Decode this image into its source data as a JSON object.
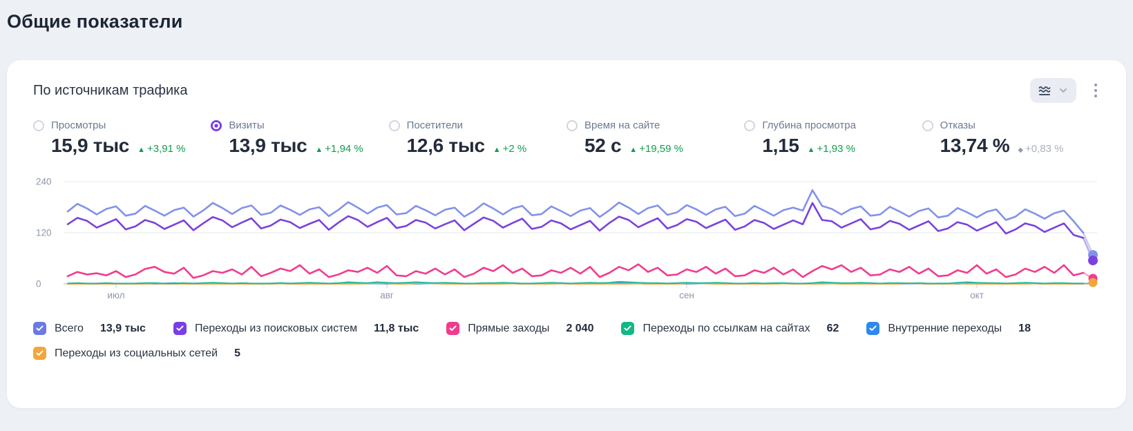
{
  "page": {
    "title": "Общие показатели"
  },
  "card": {
    "title": "По источникам трафика",
    "controls": {
      "chart_type_icon": "wave-lines-icon",
      "expand_icon": "chevron-down-icon",
      "menu_icon": "kebab-menu-icon"
    }
  },
  "metrics": [
    {
      "label": "Просмотры",
      "value": "15,9 тыс",
      "delta": "+3,91 %",
      "symbol": "▲",
      "trend": "up",
      "selected": false
    },
    {
      "label": "Визиты",
      "value": "13,9 тыс",
      "delta": "+1,94 %",
      "symbol": "▲",
      "trend": "up",
      "selected": true
    },
    {
      "label": "Посетители",
      "value": "12,6 тыс",
      "delta": "+2 %",
      "symbol": "▲",
      "trend": "up",
      "selected": false
    },
    {
      "label": "Время на сайте",
      "value": "52 с",
      "delta": "+19,59 %",
      "symbol": "▲",
      "trend": "up",
      "selected": false
    },
    {
      "label": "Глубина просмотра",
      "value": "1,15",
      "delta": "+1,93 %",
      "symbol": "▲",
      "trend": "up",
      "selected": false
    },
    {
      "label": "Отказы",
      "value": "13,74 %",
      "delta": "+0,83 %",
      "symbol": "◆",
      "trend": "neutral",
      "selected": false
    }
  ],
  "chart_data": {
    "type": "line",
    "title": "По источникам трафика",
    "metric": "Визиты",
    "x_unit": "день (июл — окт)",
    "ylim": [
      0,
      240
    ],
    "yticks": [
      0,
      120,
      240
    ],
    "xticks": [
      {
        "i": 5,
        "label": "июл"
      },
      {
        "i": 33,
        "label": "авг"
      },
      {
        "i": 64,
        "label": "сен"
      },
      {
        "i": 94,
        "label": "окт"
      }
    ],
    "grid": true,
    "legend_position": "bottom",
    "series": [
      {
        "id": "total",
        "name": "Всего",
        "value_label": "13,9 тыс",
        "color": "#8392e8",
        "checkbox_color": "#6b79e6",
        "end_dot_r": 7,
        "values": [
          170,
          188,
          177,
          163,
          176,
          182,
          160,
          165,
          183,
          172,
          160,
          173,
          179,
          158,
          172,
          190,
          178,
          164,
          178,
          184,
          162,
          167,
          184,
          174,
          162,
          175,
          180,
          159,
          174,
          192,
          179,
          165,
          179,
          185,
          163,
          166,
          183,
          173,
          161,
          174,
          179,
          158,
          171,
          189,
          177,
          163,
          177,
          183,
          161,
          164,
          182,
          171,
          159,
          172,
          178,
          157,
          173,
          191,
          179,
          164,
          178,
          184,
          162,
          168,
          185,
          175,
          162,
          175,
          181,
          159,
          165,
          183,
          172,
          160,
          173,
          179,
          172,
          220,
          183,
          176,
          163,
          176,
          182,
          160,
          163,
          181,
          170,
          158,
          171,
          177,
          156,
          160,
          178,
          168,
          156,
          169,
          175,
          150,
          158,
          175,
          165,
          153,
          166,
          172,
          147,
          120,
          68
        ]
      },
      {
        "id": "search",
        "name": "Переходы из поисковых систем",
        "value_label": "11,8 тыс",
        "color": "#7a42dd",
        "checkbox_color": "#7a3fe4",
        "end_dot_r": 7,
        "values": [
          140,
          155,
          148,
          132,
          142,
          152,
          128,
          135,
          150,
          143,
          129,
          139,
          149,
          126,
          142,
          157,
          149,
          133,
          144,
          154,
          130,
          137,
          151,
          145,
          131,
          141,
          150,
          127,
          144,
          159,
          150,
          134,
          145,
          155,
          131,
          136,
          150,
          144,
          130,
          140,
          149,
          126,
          141,
          156,
          148,
          132,
          143,
          153,
          129,
          134,
          149,
          142,
          128,
          138,
          148,
          125,
          143,
          158,
          150,
          133,
          144,
          154,
          130,
          138,
          152,
          146,
          131,
          141,
          151,
          127,
          135,
          150,
          143,
          129,
          139,
          149,
          140,
          190,
          150,
          147,
          132,
          142,
          152,
          128,
          133,
          148,
          141,
          127,
          137,
          147,
          124,
          130,
          145,
          139,
          125,
          135,
          145,
          118,
          128,
          142,
          136,
          122,
          132,
          142,
          115,
          108,
          55
        ]
      },
      {
        "id": "direct",
        "name": "Прямые заходы",
        "value_label": "2 040",
        "color": "#f13c8e",
        "checkbox_color": "#f13c8e",
        "end_dot_r": 6.5,
        "values": [
          18,
          28,
          22,
          25,
          20,
          30,
          16,
          22,
          35,
          40,
          28,
          24,
          38,
          14,
          20,
          30,
          26,
          34,
          22,
          40,
          18,
          26,
          36,
          30,
          44,
          24,
          34,
          16,
          22,
          32,
          28,
          38,
          26,
          42,
          20,
          18,
          30,
          24,
          36,
          22,
          34,
          16,
          24,
          38,
          30,
          44,
          26,
          36,
          18,
          20,
          32,
          26,
          38,
          24,
          40,
          16,
          26,
          40,
          32,
          46,
          28,
          38,
          20,
          22,
          34,
          28,
          40,
          24,
          36,
          18,
          20,
          32,
          26,
          38,
          22,
          34,
          16,
          30,
          42,
          34,
          44,
          28,
          38,
          20,
          22,
          34,
          28,
          40,
          24,
          36,
          18,
          20,
          32,
          26,
          44,
          24,
          34,
          16,
          22,
          36,
          28,
          40,
          26,
          44,
          20,
          26,
          13
        ]
      },
      {
        "id": "links",
        "name": "Переходы по ссылкам на сайтах",
        "value_label": "62",
        "color": "#27b99a",
        "checkbox_color": "#12b886",
        "end_dot_r": 4,
        "values": [
          1,
          2,
          1,
          1,
          2,
          1,
          1,
          1,
          2,
          2,
          1,
          1,
          2,
          1,
          2,
          3,
          2,
          1,
          2,
          1,
          1,
          1,
          2,
          1,
          2,
          3,
          2,
          1,
          2,
          4,
          3,
          2,
          4,
          3,
          2,
          3,
          4,
          3,
          2,
          3,
          2,
          1,
          1,
          2,
          2,
          3,
          2,
          1,
          1,
          2,
          3,
          2,
          1,
          2,
          3,
          2,
          3,
          5,
          4,
          3,
          2,
          2,
          1,
          2,
          3,
          2,
          2,
          3,
          2,
          1,
          1,
          2,
          1,
          2,
          2,
          1,
          1,
          2,
          4,
          3,
          2,
          2,
          3,
          2,
          1,
          2,
          2,
          1,
          2,
          1,
          1,
          1,
          3,
          4,
          3,
          2,
          2,
          1,
          2,
          3,
          2,
          1,
          2,
          2,
          1,
          1,
          1
        ]
      },
      {
        "id": "internal",
        "name": "Внутренние переходы",
        "value_label": "18",
        "color": "#4a90f0",
        "checkbox_color": "#2f88f0",
        "end_dot_r": 4,
        "values": [
          0,
          1,
          0,
          1,
          0,
          1,
          0,
          1,
          1,
          0,
          1,
          2,
          1,
          0,
          0,
          1,
          1,
          0,
          1,
          0,
          0,
          1,
          2,
          1,
          1,
          0,
          1,
          0,
          0,
          1,
          2,
          1,
          1,
          0,
          1,
          1,
          0,
          1,
          2,
          1,
          1,
          0,
          0,
          1,
          0,
          1,
          1,
          0,
          1,
          1,
          1,
          2,
          0,
          1,
          1,
          0,
          0,
          2,
          1,
          1,
          0,
          1,
          1,
          1,
          0,
          1,
          2,
          1,
          0,
          0,
          0,
          1,
          1,
          0,
          1,
          1,
          0,
          1,
          2,
          1,
          1,
          0,
          1,
          0,
          0,
          1,
          0,
          1,
          1,
          0,
          1,
          1,
          0,
          1,
          1,
          2,
          1,
          0,
          0,
          1,
          1,
          0,
          1,
          0,
          1,
          1,
          0
        ]
      },
      {
        "id": "social",
        "name": "Переходы из социальных сетей",
        "value_label": "5",
        "color": "#f2a63d",
        "checkbox_color": "#f2a63d",
        "end_dot_r": 6.5,
        "values": [
          0,
          0,
          0,
          0,
          0,
          0,
          0,
          0,
          0,
          1,
          0,
          0,
          0,
          0,
          0,
          0,
          0,
          0,
          0,
          0,
          0,
          0,
          1,
          0,
          0,
          0,
          0,
          0,
          0,
          0,
          0,
          1,
          2,
          1,
          0,
          0,
          1,
          2,
          1,
          0,
          0,
          0,
          0,
          0,
          0,
          0,
          1,
          0,
          0,
          0,
          0,
          1,
          0,
          0,
          0,
          0,
          0,
          0,
          0,
          1,
          0,
          0,
          0,
          0,
          1,
          2,
          1,
          0,
          0,
          0,
          0,
          0,
          0,
          0,
          1,
          0,
          0,
          0,
          0,
          1,
          0,
          0,
          0,
          0,
          0,
          0,
          0,
          2,
          1,
          0,
          0,
          0,
          1,
          0,
          0,
          0,
          0,
          0,
          0,
          0,
          1,
          0,
          0,
          0,
          0,
          0,
          3
        ]
      }
    ]
  }
}
